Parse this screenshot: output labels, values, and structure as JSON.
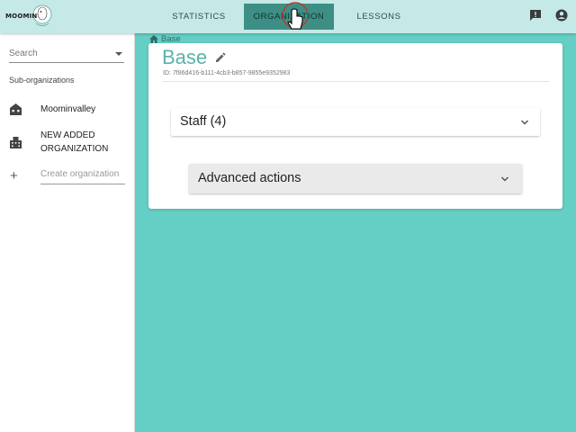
{
  "app": {
    "logo_text": "MOOMIN"
  },
  "nav": {
    "tabs": [
      {
        "label": "STATISTICS",
        "active": false
      },
      {
        "label": "ORGANIZATION",
        "active": true
      },
      {
        "label": "LESSONS",
        "active": false
      }
    ],
    "icons": [
      "feedback-icon",
      "account-icon"
    ]
  },
  "sidebar": {
    "search_label": "Search",
    "subheading": "Sub-organizations",
    "items": [
      {
        "label": "Moominvalley",
        "icon": "house-icon"
      },
      {
        "label": "NEW ADDED ORGANIZATION",
        "icon": "building-icon"
      }
    ],
    "create_placeholder": "Create organization",
    "create_icon": "plus-icon"
  },
  "main": {
    "breadcrumb": "Base",
    "title": "Base",
    "id_line": "ID: 7f86d416-b111-4cb3-b857-9855e9352983",
    "panels": [
      {
        "label": "Staff (4)"
      },
      {
        "label": "Advanced actions"
      }
    ]
  },
  "colors": {
    "background": "#66cfc5",
    "topbar": "#c5e9e6",
    "active_tab": "#3d8f86",
    "title": "#5ab3aa"
  }
}
